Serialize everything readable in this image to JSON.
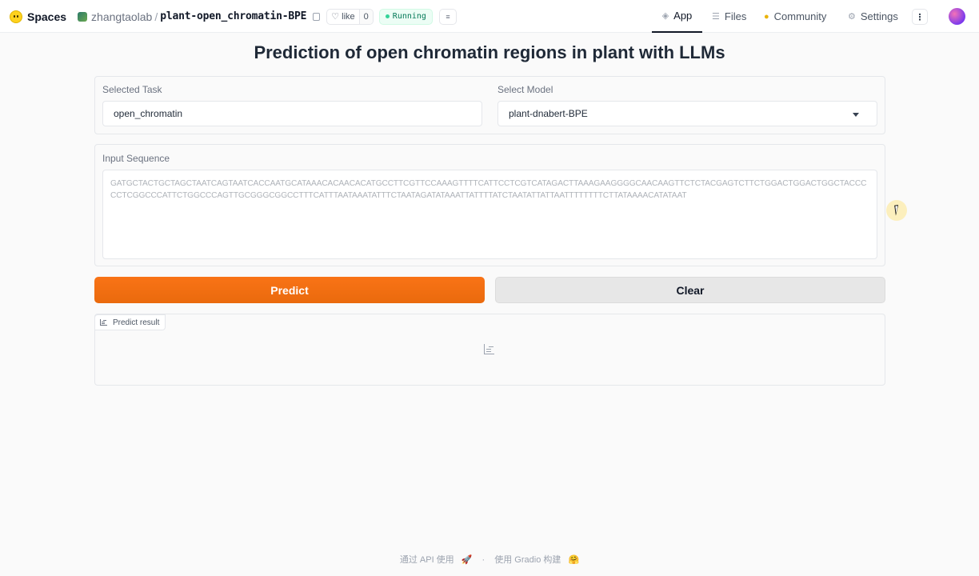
{
  "topbar": {
    "brand": "Spaces",
    "owner": "zhangtaolab",
    "separator": "/",
    "repo": "plant-open_chromatin-BPE",
    "like_label": "like",
    "like_count": "0",
    "status": "Running",
    "tabs": [
      {
        "label": "App",
        "icon": "cube-icon",
        "active": true
      },
      {
        "label": "Files",
        "icon": "files-icon",
        "active": false
      },
      {
        "label": "Community",
        "icon": "community-icon",
        "active": false
      },
      {
        "label": "Settings",
        "icon": "gear-icon",
        "active": false
      }
    ]
  },
  "main": {
    "title": "Prediction of open chromatin regions in plant with LLMs",
    "task": {
      "label": "Selected Task",
      "value": "open_chromatin"
    },
    "model": {
      "label": "Select Model",
      "value": "plant-dnabert-BPE"
    },
    "sequence": {
      "label": "Input Sequence",
      "placeholder": "GATGCTACTGCTAGCTAATCAGTAATCACCAATGCATAAACACAACACATGCCTTCGTTCCAAAGTTTTCATTCCTCGTCATAGACTTAAAGAAGGGGCAACAAGTTCTCTACGAGTCTTCTGGACTGGACTGGCTACCCCCTCGGCCCATTCTGGCCCAGTTGCGGGCGGCCTTTCATTTAATAAATATTTCTAATAGATATAAATTATTTTATCTAATATTATTAATTTTTTTTCTTATAAAACATATAAT"
    },
    "predict_button": "Predict",
    "clear_button": "Clear",
    "result_label": "Predict result"
  },
  "footer": {
    "api_text": "通过 API 使用",
    "api_icon": "🚀",
    "dot": "·",
    "built_text": "使用 Gradio 构建",
    "built_icon": "🤗"
  },
  "colors": {
    "accent": "#f97316",
    "status_green": "#047857"
  }
}
